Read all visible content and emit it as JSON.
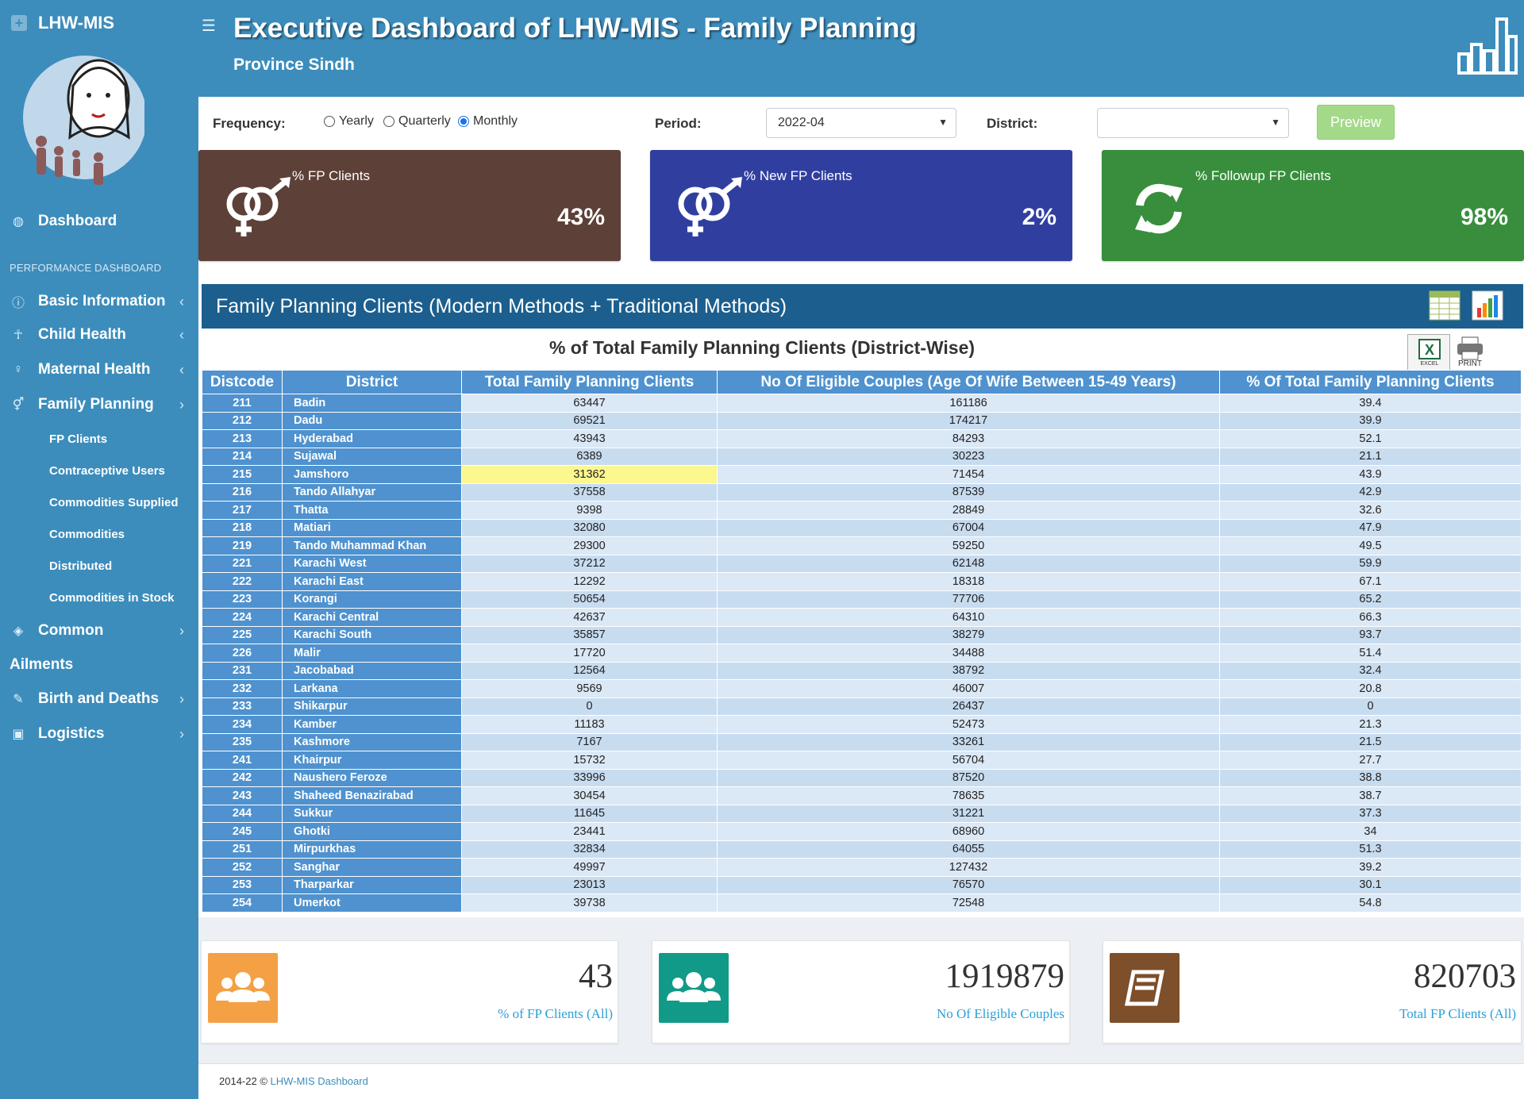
{
  "brand": {
    "name": "LHW-MIS"
  },
  "sidebar": {
    "dashboard": "Dashboard",
    "section_header": "PERFORMANCE DASHBOARD",
    "items": [
      {
        "label": "Basic Information",
        "chev": "‹"
      },
      {
        "label": "Child Health",
        "chev": "‹"
      },
      {
        "label": "Maternal Health",
        "chev": "‹"
      },
      {
        "label": "Family Planning",
        "chev": "›"
      }
    ],
    "sub_items": [
      "FP Clients",
      "Contraceptive Users",
      "Commodities Supplied",
      "Commodities",
      "Distributed",
      "Commodities in Stock"
    ],
    "common": "Common",
    "ailments": "Ailments",
    "births": "Birth and Deaths",
    "logistics": "Logistics"
  },
  "header": {
    "title": "Executive Dashboard of LHW-MIS - Family Planning",
    "subtitle": "Province Sindh"
  },
  "filters": {
    "frequency_label": "Frequency:",
    "options": [
      "Yearly",
      "Quarterly",
      "Monthly"
    ],
    "selected": "Monthly",
    "period_label": "Period:",
    "period_value": "2022-04",
    "district_label": "District:",
    "district_value": "",
    "preview": "Preview"
  },
  "infoboxes": [
    {
      "label": "% FP Clients",
      "value": "43%",
      "color": "#5d4037"
    },
    {
      "label": "% New FP Clients",
      "value": "2%",
      "color": "#303f9f"
    },
    {
      "label": "% Followup FP Clients",
      "value": "98%",
      "color": "#388e3c"
    }
  ],
  "panel": {
    "title": "Family Planning Clients (Modern Methods + Traditional Methods)",
    "caption": "% of Total Family Planning Clients (District-Wise)",
    "excel": "EXCEL",
    "print": "PRINT"
  },
  "table": {
    "headers": [
      "Distcode",
      "District",
      "Total Family Planning Clients",
      "No Of Eligible Couples (Age Of Wife Between 15-49 Years)",
      "% Of Total Family Planning Clients"
    ],
    "rows": [
      [
        "211",
        "Badin",
        "63447",
        "161186",
        "39.4"
      ],
      [
        "212",
        "Dadu",
        "69521",
        "174217",
        "39.9"
      ],
      [
        "213",
        "Hyderabad",
        "43943",
        "84293",
        "52.1"
      ],
      [
        "214",
        "Sujawal",
        "6389",
        "30223",
        "21.1"
      ],
      [
        "215",
        "Jamshoro",
        "31362",
        "71454",
        "43.9"
      ],
      [
        "216",
        "Tando Allahyar",
        "37558",
        "87539",
        "42.9"
      ],
      [
        "217",
        "Thatta",
        "9398",
        "28849",
        "32.6"
      ],
      [
        "218",
        "Matiari",
        "32080",
        "67004",
        "47.9"
      ],
      [
        "219",
        "Tando Muhammad Khan",
        "29300",
        "59250",
        "49.5"
      ],
      [
        "221",
        "Karachi West",
        "37212",
        "62148",
        "59.9"
      ],
      [
        "222",
        "Karachi East",
        "12292",
        "18318",
        "67.1"
      ],
      [
        "223",
        "Korangi",
        "50654",
        "77706",
        "65.2"
      ],
      [
        "224",
        "Karachi Central",
        "42637",
        "64310",
        "66.3"
      ],
      [
        "225",
        "Karachi South",
        "35857",
        "38279",
        "93.7"
      ],
      [
        "226",
        "Malir",
        "17720",
        "34488",
        "51.4"
      ],
      [
        "231",
        "Jacobabad",
        "12564",
        "38792",
        "32.4"
      ],
      [
        "232",
        "Larkana",
        "9569",
        "46007",
        "20.8"
      ],
      [
        "233",
        "Shikarpur",
        "0",
        "26437",
        "0"
      ],
      [
        "234",
        "Kamber",
        "11183",
        "52473",
        "21.3"
      ],
      [
        "235",
        "Kashmore",
        "7167",
        "33261",
        "21.5"
      ],
      [
        "241",
        "Khairpur",
        "15732",
        "56704",
        "27.7"
      ],
      [
        "242",
        "Naushero Feroze",
        "33996",
        "87520",
        "38.8"
      ],
      [
        "243",
        "Shaheed Benazirabad",
        "30454",
        "78635",
        "38.7"
      ],
      [
        "244",
        "Sukkur",
        "11645",
        "31221",
        "37.3"
      ],
      [
        "245",
        "Ghotki",
        "23441",
        "68960",
        "34"
      ],
      [
        "251",
        "Mirpurkhas",
        "32834",
        "64055",
        "51.3"
      ],
      [
        "252",
        "Sanghar",
        "49997",
        "127432",
        "39.2"
      ],
      [
        "253",
        "Tharparkar",
        "23013",
        "76570",
        "30.1"
      ],
      [
        "254",
        "Umerkot",
        "39738",
        "72548",
        "54.8"
      ]
    ],
    "highlight_row": 4
  },
  "stats": [
    {
      "value": "43",
      "label": "% of FP Clients (All)",
      "color": "#f4a044"
    },
    {
      "value": "1919879",
      "label": "No Of Eligible Couples",
      "color": "#119a88"
    },
    {
      "value": "820703",
      "label": "Total FP Clients (All)",
      "color": "#7d4f2a"
    }
  ],
  "footer": {
    "copy": "2014-22 © ",
    "link": "LHW-MIS Dashboard"
  }
}
